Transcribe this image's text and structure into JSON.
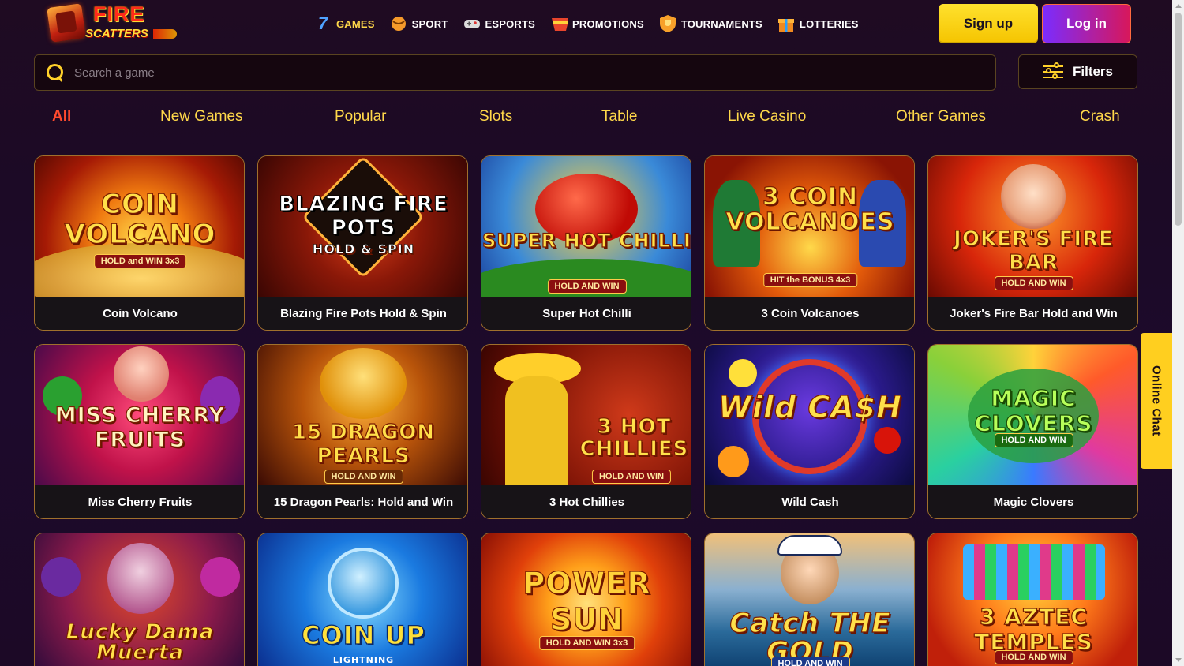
{
  "brand": {
    "line1": "FIRE",
    "line2": "SCATTERS"
  },
  "nav": [
    {
      "label": "GAMES",
      "icon": "slot-seven-icon",
      "active": true
    },
    {
      "label": "SPORT",
      "icon": "sport-ball-icon"
    },
    {
      "label": "ESPORTS",
      "icon": "gamepad-icon"
    },
    {
      "label": "PROMOTIONS",
      "icon": "bonus-badge-icon"
    },
    {
      "label": "TOURNAMENTS",
      "icon": "trophy-shield-icon"
    },
    {
      "label": "LOTTERIES",
      "icon": "gift-box-icon"
    }
  ],
  "auth": {
    "signup": "Sign up",
    "login": "Log in"
  },
  "search": {
    "placeholder": "Search a game"
  },
  "filters": {
    "label": "Filters"
  },
  "tabs": [
    "All",
    "New Games",
    "Popular",
    "Slots",
    "Table",
    "Live Casino",
    "Other Games",
    "Crash"
  ],
  "games": [
    {
      "name": "Coin Volcano",
      "art_title": "COIN VOLCANO",
      "art_sub": "HOLD and WIN 3x3"
    },
    {
      "name": "Blazing Fire Pots Hold & Spin",
      "art_title": "BLAZING FIRE POTS",
      "art_sub": "HOLD & SPIN"
    },
    {
      "name": "Super Hot Chilli",
      "art_title": "SUPER HOT CHILLI",
      "art_sub": "HOLD AND WIN"
    },
    {
      "name": "3 Coin Volcanoes",
      "art_title": "3 COIN VOLCANOES",
      "art_sub": "HIT the BONUS 4x3"
    },
    {
      "name": "Joker's Fire Bar Hold and Win",
      "art_title": "JOKER'S FIRE BAR",
      "art_sub": "HOLD AND WIN"
    },
    {
      "name": "Miss Cherry Fruits",
      "art_title": "MISS CHERRY FRUITS",
      "art_sub": ""
    },
    {
      "name": "15 Dragon Pearls: Hold and Win",
      "art_title": "15 DRAGON PEARLS",
      "art_sub": "HOLD AND WIN"
    },
    {
      "name": "3 Hot Chillies",
      "art_title": "3 HOT CHILLIES",
      "art_sub": "HOLD AND WIN"
    },
    {
      "name": "Wild Cash",
      "art_title": "Wild CA$H",
      "art_sub": ""
    },
    {
      "name": "Magic Clovers",
      "art_title": "MAGIC CLOVERS",
      "art_sub": "HOLD AND WIN"
    },
    {
      "name": "",
      "art_title": "Lucky Dama Muerta",
      "art_sub": ""
    },
    {
      "name": "",
      "art_title": "COIN UP",
      "art_sub": "LIGHTNING"
    },
    {
      "name": "",
      "art_title": "POWER SUN",
      "art_sub": "HOLD AND WIN 3x3"
    },
    {
      "name": "",
      "art_title": "Catch THE GOLD",
      "art_sub": "HOLD AND WIN"
    },
    {
      "name": "",
      "art_title": "3 AZTEC TEMPLES",
      "art_sub": "HOLD AND WIN"
    }
  ],
  "chat": {
    "label": "Online Chat"
  },
  "colors": {
    "accent": "#ffd12a",
    "login_gradient": [
      "#7a2cff",
      "#d8175a"
    ],
    "active_tab": "#ff4a2e"
  }
}
